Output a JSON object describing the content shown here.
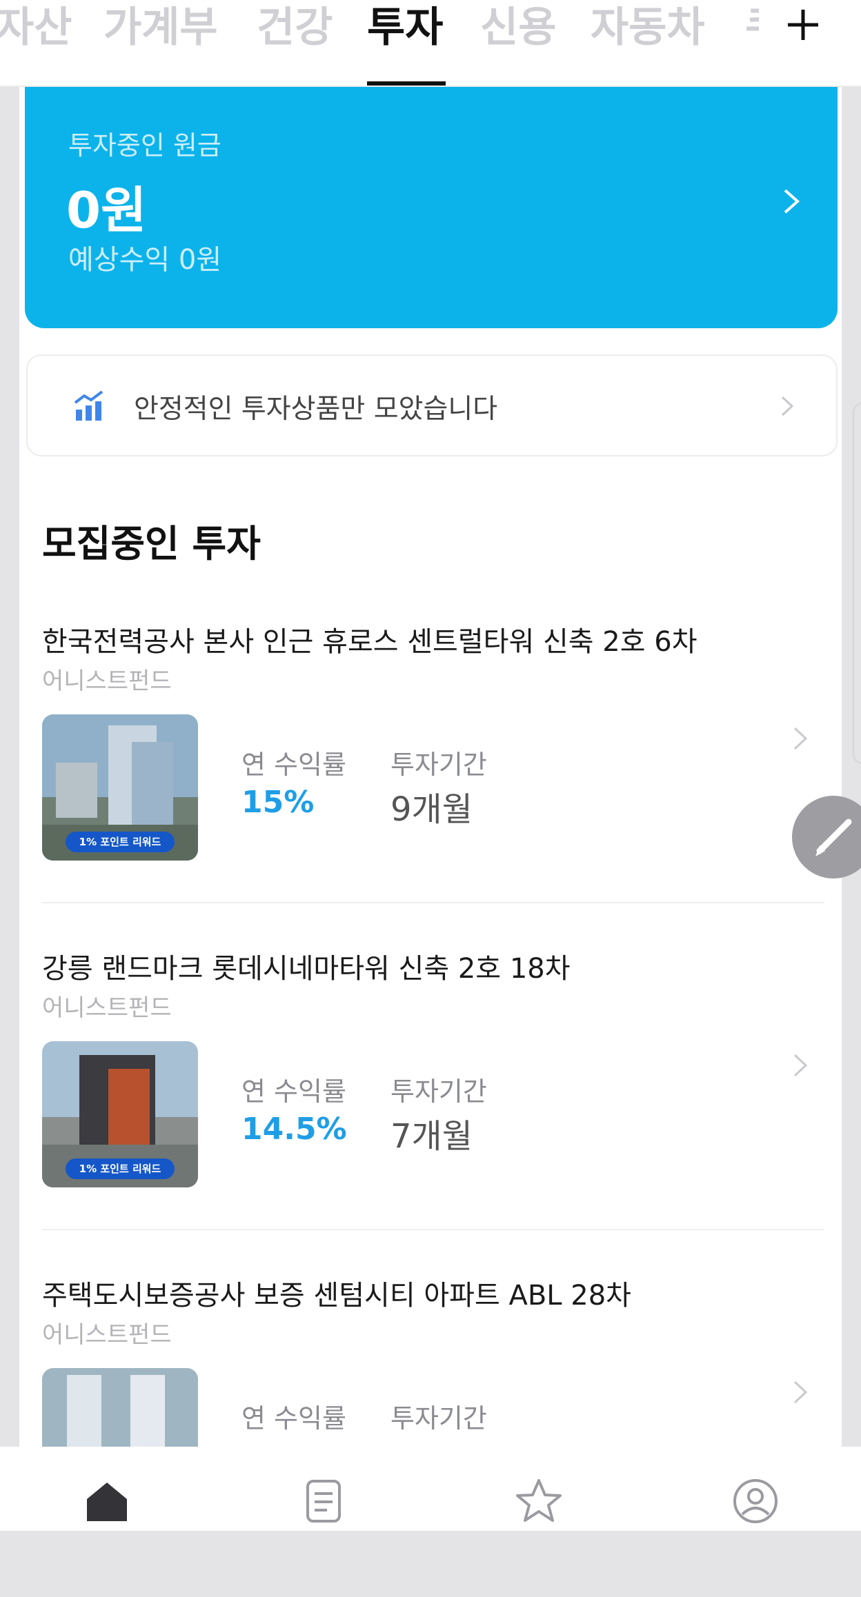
{
  "tabs": [
    {
      "label": "자산"
    },
    {
      "label": "가계부"
    },
    {
      "label": "건강"
    },
    {
      "label": "투자"
    },
    {
      "label": "신용"
    },
    {
      "label": "자동차"
    },
    {
      "label": "쿠"
    }
  ],
  "summary": {
    "label": "투자중인 원금",
    "amount": "0원",
    "expected": "예상수익 0원"
  },
  "banner": {
    "text": "안정적인 투자상품만 모았습니다"
  },
  "section_title": "모집중인 투자",
  "items": [
    {
      "title": "한국전력공사 본사 인근 휴로스 센트럴타워 신축 2호 6차",
      "provider": "어니스트펀드",
      "rate_label": "연 수익률",
      "rate": "15%",
      "term_label": "투자기간",
      "term": "9개월",
      "badge": "1% 포인트 리워드"
    },
    {
      "title": "강릉 랜드마크 롯데시네마타워 신축 2호 18차",
      "provider": "어니스트펀드",
      "rate_label": "연 수익률",
      "rate": "14.5%",
      "term_label": "투자기간",
      "term": "7개월",
      "badge": "1% 포인트 리워드"
    },
    {
      "title": "주택도시보증공사 보증 센텀시티 아파트 ABL 28차",
      "provider": "어니스트펀드",
      "rate_label": "연 수익률",
      "rate": "",
      "term_label": "투자기간",
      "term": "",
      "badge": ""
    }
  ],
  "colors": {
    "accent": "#0cb3ea",
    "rate": "#1f9ee6",
    "fab": "#9d9da2"
  },
  "icons": {
    "add": "plus-icon",
    "banner": "bar-chart-icon",
    "edit": "pencil-icon",
    "nav": [
      "home-icon",
      "document-icon",
      "star-icon",
      "profile-icon"
    ]
  }
}
